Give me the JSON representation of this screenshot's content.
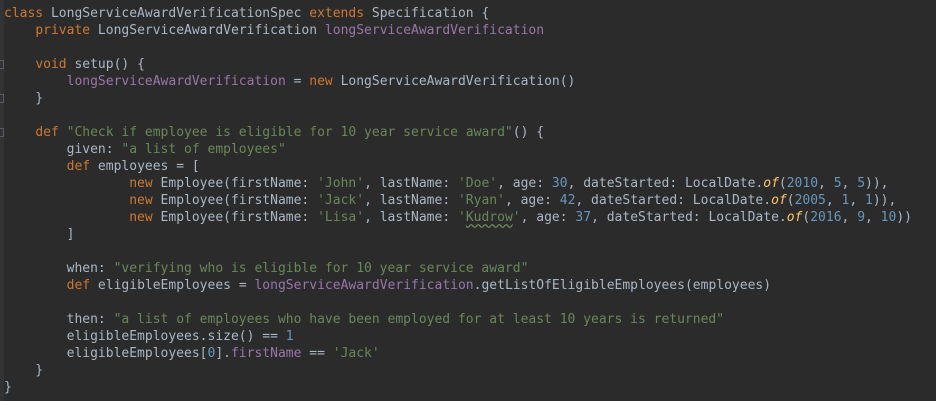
{
  "editor": {
    "language": "groovy",
    "colors": {
      "background": "#2b2b2b",
      "keyword": "#cc7832",
      "string": "#6a8759",
      "number": "#6897bb",
      "field": "#9876aa",
      "static_method": "#ffc66d",
      "plain": "#a9b7c6"
    },
    "lines": [
      {
        "tokens": [
          {
            "t": "class",
            "k": "kw"
          },
          {
            "t": " LongServiceAwardVerificationSpec ",
            "k": "plain"
          },
          {
            "t": "extends",
            "k": "kw"
          },
          {
            "t": " Specification {",
            "k": "plain"
          }
        ]
      },
      {
        "tokens": [
          {
            "t": "    ",
            "k": "plain"
          },
          {
            "t": "private",
            "k": "kw"
          },
          {
            "t": " LongServiceAwardVerification ",
            "k": "plain"
          },
          {
            "t": "longServiceAwardVerification",
            "k": "field"
          }
        ]
      },
      {
        "tokens": []
      },
      {
        "tokens": [
          {
            "t": "    ",
            "k": "plain"
          },
          {
            "t": "void",
            "k": "kw"
          },
          {
            "t": " setup() {",
            "k": "plain"
          }
        ]
      },
      {
        "tokens": [
          {
            "t": "        ",
            "k": "plain"
          },
          {
            "t": "longServiceAwardVerification",
            "k": "field"
          },
          {
            "t": " = ",
            "k": "plain"
          },
          {
            "t": "new",
            "k": "kw"
          },
          {
            "t": " LongServiceAwardVerification()",
            "k": "plain"
          }
        ]
      },
      {
        "tokens": [
          {
            "t": "    }",
            "k": "plain"
          }
        ]
      },
      {
        "tokens": []
      },
      {
        "tokens": [
          {
            "t": "    ",
            "k": "plain"
          },
          {
            "t": "def",
            "k": "kw"
          },
          {
            "t": " ",
            "k": "plain"
          },
          {
            "t": "\"Check if employee is eligible for 10 year service award\"",
            "k": "str"
          },
          {
            "t": "() {",
            "k": "plain"
          }
        ]
      },
      {
        "tokens": [
          {
            "t": "        given: ",
            "k": "plain"
          },
          {
            "t": "\"a list of employees\"",
            "k": "str"
          }
        ]
      },
      {
        "tokens": [
          {
            "t": "        ",
            "k": "plain"
          },
          {
            "t": "def",
            "k": "kw"
          },
          {
            "t": " employees = [",
            "k": "plain"
          }
        ]
      },
      {
        "tokens": [
          {
            "t": "                ",
            "k": "plain"
          },
          {
            "t": "new",
            "k": "kw"
          },
          {
            "t": " Employee(firstName: ",
            "k": "plain"
          },
          {
            "t": "'John'",
            "k": "str"
          },
          {
            "t": ", lastName: ",
            "k": "plain"
          },
          {
            "t": "'Doe'",
            "k": "str"
          },
          {
            "t": ", age: ",
            "k": "plain"
          },
          {
            "t": "30",
            "k": "num"
          },
          {
            "t": ", dateStarted: LocalDate.",
            "k": "plain"
          },
          {
            "t": "of",
            "k": "static"
          },
          {
            "t": "(",
            "k": "plain"
          },
          {
            "t": "2010",
            "k": "num"
          },
          {
            "t": ", ",
            "k": "plain"
          },
          {
            "t": "5",
            "k": "num"
          },
          {
            "t": ", ",
            "k": "plain"
          },
          {
            "t": "5",
            "k": "num"
          },
          {
            "t": ")),",
            "k": "plain"
          }
        ]
      },
      {
        "tokens": [
          {
            "t": "                ",
            "k": "plain"
          },
          {
            "t": "new",
            "k": "kw"
          },
          {
            "t": " Employee(firstName: ",
            "k": "plain"
          },
          {
            "t": "'Jack'",
            "k": "str"
          },
          {
            "t": ", lastName: ",
            "k": "plain"
          },
          {
            "t": "'Ryan'",
            "k": "str"
          },
          {
            "t": ", age: ",
            "k": "plain"
          },
          {
            "t": "42",
            "k": "num"
          },
          {
            "t": ", dateStarted: LocalDate.",
            "k": "plain"
          },
          {
            "t": "of",
            "k": "static"
          },
          {
            "t": "(",
            "k": "plain"
          },
          {
            "t": "2005",
            "k": "num"
          },
          {
            "t": ", ",
            "k": "plain"
          },
          {
            "t": "1",
            "k": "num"
          },
          {
            "t": ", ",
            "k": "plain"
          },
          {
            "t": "1",
            "k": "num"
          },
          {
            "t": ")),",
            "k": "plain"
          }
        ]
      },
      {
        "tokens": [
          {
            "t": "                ",
            "k": "plain"
          },
          {
            "t": "new",
            "k": "kw"
          },
          {
            "t": " Employee(firstName: ",
            "k": "plain"
          },
          {
            "t": "'Lisa'",
            "k": "str"
          },
          {
            "t": ", lastName: ",
            "k": "plain"
          },
          {
            "t": "'",
            "k": "str"
          },
          {
            "t": "Kudrow",
            "k": "strsq"
          },
          {
            "t": "'",
            "k": "str"
          },
          {
            "t": ", age: ",
            "k": "plain"
          },
          {
            "t": "37",
            "k": "num"
          },
          {
            "t": ", dateStarted: LocalDate.",
            "k": "plain"
          },
          {
            "t": "of",
            "k": "static"
          },
          {
            "t": "(",
            "k": "plain"
          },
          {
            "t": "2016",
            "k": "num"
          },
          {
            "t": ", ",
            "k": "plain"
          },
          {
            "t": "9",
            "k": "num"
          },
          {
            "t": ", ",
            "k": "plain"
          },
          {
            "t": "10",
            "k": "num"
          },
          {
            "t": "))",
            "k": "plain"
          }
        ]
      },
      {
        "tokens": [
          {
            "t": "        ]",
            "k": "plain"
          }
        ]
      },
      {
        "tokens": []
      },
      {
        "tokens": [
          {
            "t": "        when: ",
            "k": "plain"
          },
          {
            "t": "\"verifying who is eligible for 10 year service award\"",
            "k": "str"
          }
        ]
      },
      {
        "tokens": [
          {
            "t": "        ",
            "k": "plain"
          },
          {
            "t": "def",
            "k": "kw"
          },
          {
            "t": " eligibleEmployees = ",
            "k": "plain"
          },
          {
            "t": "longServiceAwardVerification",
            "k": "field"
          },
          {
            "t": ".getListOfEligibleEmployees(employees)",
            "k": "plain"
          }
        ]
      },
      {
        "tokens": []
      },
      {
        "tokens": [
          {
            "t": "        then: ",
            "k": "plain"
          },
          {
            "t": "\"a list of employees who have been employed for at least 10 years is returned\"",
            "k": "str"
          }
        ]
      },
      {
        "tokens": [
          {
            "t": "        eligibleEmployees.size() == ",
            "k": "plain"
          },
          {
            "t": "1",
            "k": "num"
          }
        ]
      },
      {
        "tokens": [
          {
            "t": "        eligibleEmployees[",
            "k": "plain"
          },
          {
            "t": "0",
            "k": "num"
          },
          {
            "t": "].",
            "k": "plain"
          },
          {
            "t": "firstName",
            "k": "field"
          },
          {
            "t": " == ",
            "k": "plain"
          },
          {
            "t": "'Jack'",
            "k": "str"
          }
        ]
      },
      {
        "tokens": [
          {
            "t": "    }",
            "k": "plain"
          }
        ]
      },
      {
        "tokens": [
          {
            "t": "}",
            "k": "plain"
          }
        ]
      }
    ]
  }
}
